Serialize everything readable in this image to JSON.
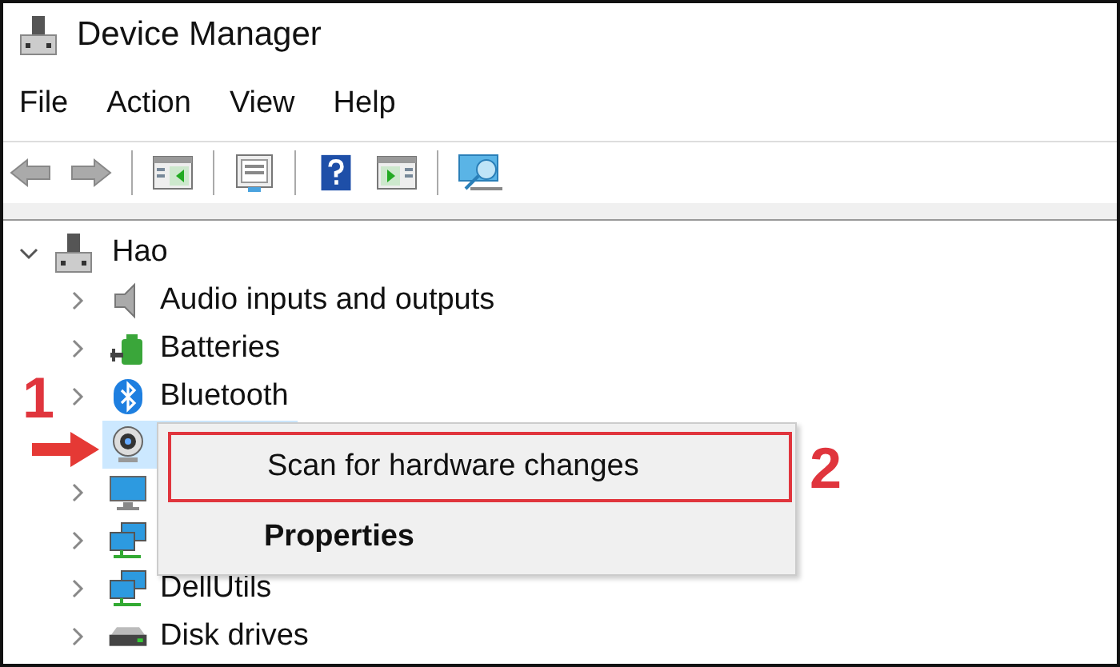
{
  "window": {
    "title": "Device Manager"
  },
  "menu": [
    {
      "label": "File"
    },
    {
      "label": "Action"
    },
    {
      "label": "View"
    },
    {
      "label": "Help"
    }
  ],
  "tree": {
    "label": "Hao",
    "expanded": true,
    "children": [
      {
        "kind": "audio",
        "label": "Audio inputs and outputs",
        "expanded": false,
        "selected": false
      },
      {
        "kind": "battery",
        "label": "Batteries",
        "expanded": false,
        "selected": false
      },
      {
        "kind": "bluetooth",
        "label": "Bluetooth",
        "expanded": false,
        "selected": false
      },
      {
        "kind": "camera",
        "selected": true
      },
      {
        "kind": "monitor",
        "expanded": false,
        "selected": false
      },
      {
        "kind": "network",
        "expanded": false,
        "selected": false
      },
      {
        "kind": "network",
        "label": "DellUtils",
        "expanded": false,
        "selected": false
      },
      {
        "kind": "disk",
        "label": "Disk drives",
        "expanded": false,
        "selected": false
      }
    ]
  },
  "context_menu": {
    "items": [
      {
        "label": "Scan for hardware changes",
        "bold": false,
        "outlined": true
      },
      {
        "label": "Properties",
        "bold": true,
        "outlined": false
      }
    ]
  },
  "annotations": [
    {
      "text": "1"
    },
    {
      "text": "2"
    }
  ]
}
